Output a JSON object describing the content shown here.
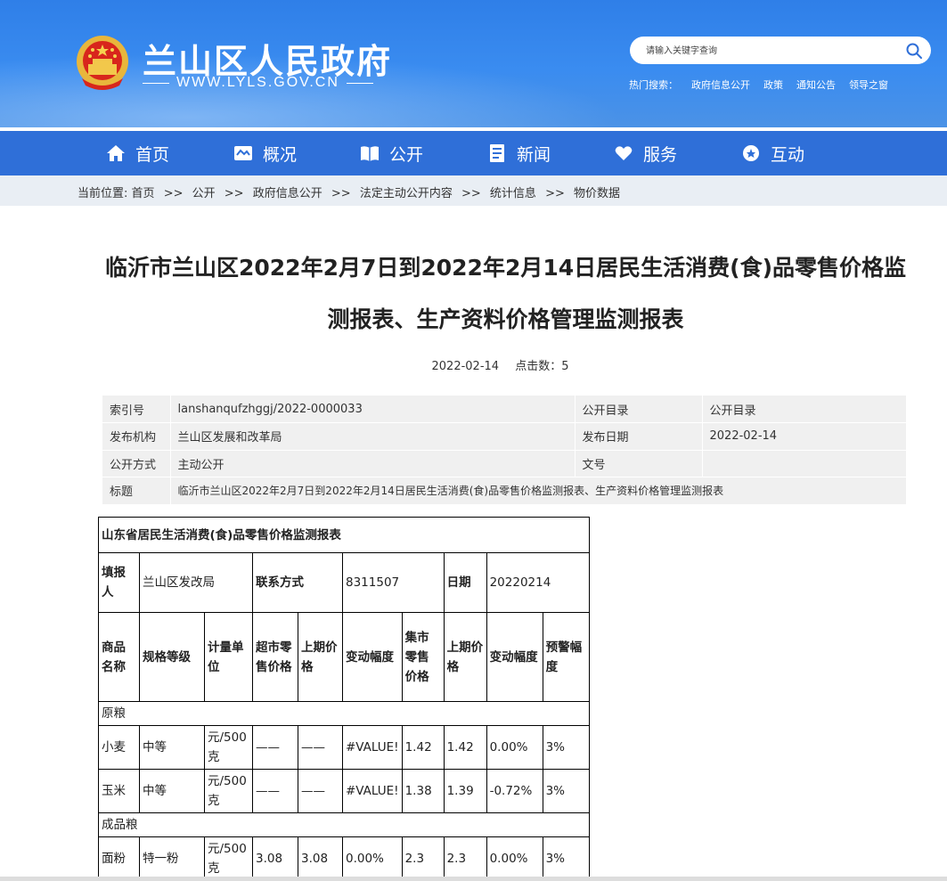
{
  "header": {
    "site_title": "兰山区人民政府",
    "site_url": "WWW.LYLS.GOV.CN",
    "search_placeholder": "请输入关键字查询",
    "hot_label": "热门搜索：",
    "hot_links": [
      "政府信息公开",
      "政策",
      "通知公告",
      "领导之窗"
    ]
  },
  "nav": {
    "items": [
      {
        "label": "首页",
        "icon": "home-icon"
      },
      {
        "label": "概况",
        "icon": "overview-icon"
      },
      {
        "label": "公开",
        "icon": "book-icon"
      },
      {
        "label": "新闻",
        "icon": "news-icon"
      },
      {
        "label": "服务",
        "icon": "heart-hand-icon"
      },
      {
        "label": "互动",
        "icon": "chat-icon"
      }
    ]
  },
  "breadcrumb": {
    "prefix": "当前位置:",
    "sep": ">>",
    "items": [
      "首页",
      "公开",
      "政府信息公开",
      "法定主动公开内容",
      "统计信息",
      "物价数据"
    ]
  },
  "article": {
    "title_line1": "临沂市兰山区2022年2月7日到2022年2月14日居民生活消费(食)品零售价格监",
    "title_line2": "测报表、生产资料价格管理监测报表",
    "date": "2022-02-14",
    "clicks": "点击数：5"
  },
  "info": {
    "index_label": "索引号",
    "index_value": "lanshanqufzhggj/2022-0000033",
    "catalog_label": "公开目录",
    "catalog_value": "公开目录",
    "org_label": "发布机构",
    "org_value": "兰山区发展和改革局",
    "pubdate_label": "发布日期",
    "pubdate_value": "2022-02-14",
    "mode_label": "公开方式",
    "mode_value": "主动公开",
    "docno_label": "文号",
    "docno_value": "",
    "title_label": "标题",
    "title_value": "临沂市兰山区2022年2月7日到2022年2月14日居民生活消费(食)品零售价格监测报表、生产资料价格管理监测报表"
  },
  "price_table": {
    "caption": "山东省居民生活消费(食)品零售价格监测报表",
    "filler_label": "填报人",
    "filler_value": "兰山区发改局",
    "contact_label": "联系方式",
    "contact_value": "8311507",
    "date_label": "日期",
    "date_value": "20220214",
    "headers": [
      "商品名称",
      "规格等级",
      "计量单位",
      "超市零售价格",
      "上期价格",
      "变动幅度",
      "集市零售价格",
      "上期价格",
      "变动幅度",
      "预警幅度"
    ],
    "groups": [
      {
        "name": "原粮",
        "rows": [
          [
            "小麦",
            "中等",
            "元/500克",
            "——",
            "——",
            "#VALUE!",
            "1.42",
            "1.42",
            "0.00%",
            "3%"
          ],
          [
            "玉米",
            "中等",
            "元/500克",
            "——",
            "——",
            "#VALUE!",
            "1.38",
            "1.39",
            "-0.72%",
            "3%"
          ]
        ]
      },
      {
        "name": "成品粮",
        "rows": [
          [
            "面粉",
            "特一粉",
            "元/500克",
            "3.08",
            "3.08",
            "0.00%",
            "2.3",
            "2.3",
            "0.00%",
            "3%"
          ]
        ]
      }
    ]
  }
}
